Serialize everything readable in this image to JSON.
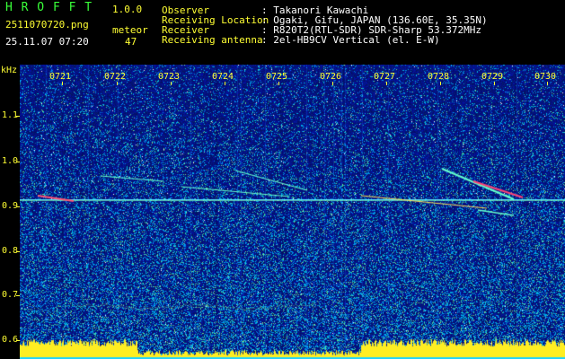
{
  "header": {
    "app_name": "H R O F F T",
    "version": "1.0.0",
    "filename": "2511070720.png",
    "date_time": "25.11.07 07:20",
    "meteor_label": "meteor",
    "meteor_count": "47",
    "info": [
      {
        "label": "Observer",
        "value": ": Takanori Kawachi"
      },
      {
        "label": "Receiving Location",
        "value": ": Ogaki, Gifu, JAPAN (136.60E, 35.35N)"
      },
      {
        "label": "Receiver",
        "value": ": R820T2(RTL-SDR) SDR-Sharp 53.372MHz"
      },
      {
        "label": "Receiving antenna",
        "value": ": 2el-HB9CV Vertical (el. E-W)"
      }
    ]
  },
  "axes": {
    "y_unit": "kHz",
    "y_ticks": [
      "1.1",
      "1.0",
      "0.9",
      "0.8",
      "0.7",
      "0.6"
    ],
    "x_ticks": [
      "0721",
      "0722",
      "0723",
      "0724",
      "0725",
      "0726",
      "0727",
      "0728",
      "0729",
      "0730"
    ]
  },
  "colors": {
    "label_green": "#39ff39",
    "label_yellow": "#ffff33",
    "background": "#000000",
    "spectrogram_noise": "#0a1a8c",
    "meteor_trace": "#ff3366"
  }
}
